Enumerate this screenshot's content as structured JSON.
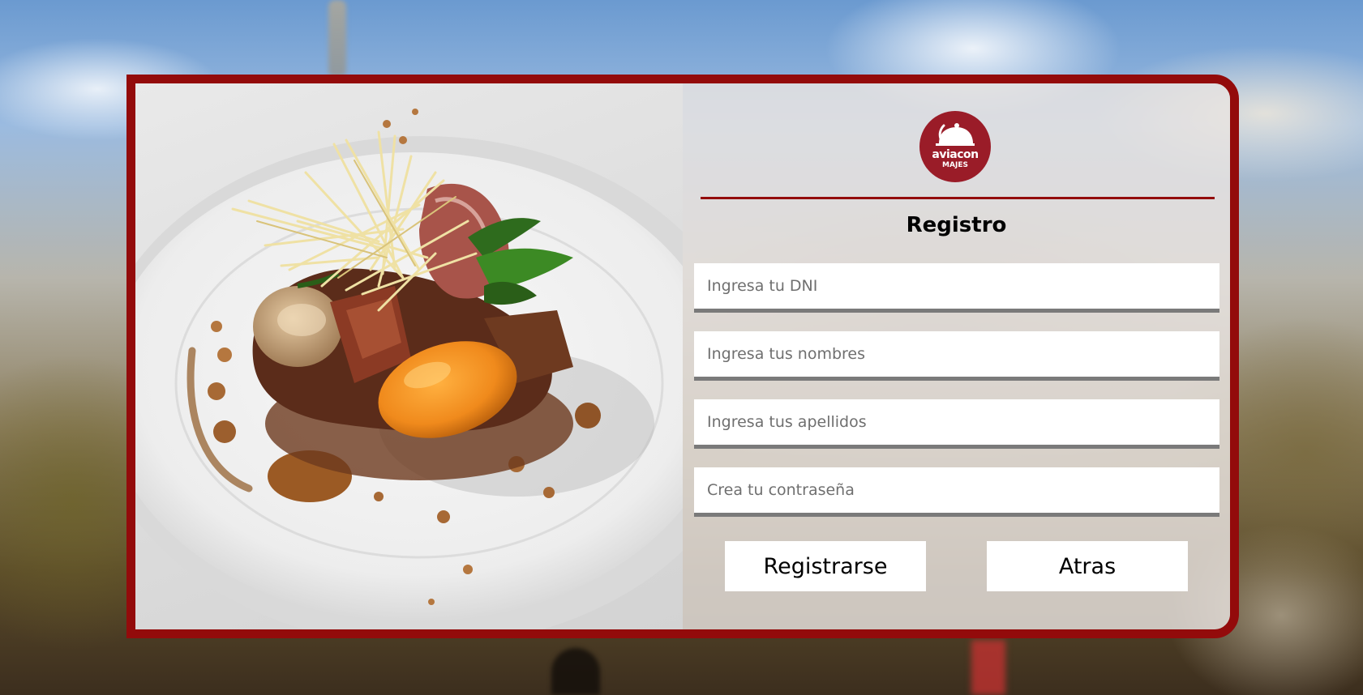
{
  "brand": {
    "name": "aviacon",
    "subtitle": "MAJES",
    "color": "#9a1c28",
    "accent_border": "#930b0b"
  },
  "form": {
    "title": "Registro",
    "fields": [
      {
        "id": "dni",
        "placeholder": "Ingresa tu DNI",
        "value": ""
      },
      {
        "id": "nombres",
        "placeholder": "Ingresa tus nombres",
        "value": ""
      },
      {
        "id": "apellidos",
        "placeholder": "Ingresa tus apellidos",
        "value": ""
      },
      {
        "id": "contrasena",
        "placeholder": "Crea tu contraseña",
        "value": ""
      }
    ],
    "buttons": {
      "register_label": "Registrarse",
      "back_label": "Atras"
    }
  },
  "images": {
    "food_photo": "plated-dish-photo",
    "background": "blurred-landscape-photo"
  }
}
